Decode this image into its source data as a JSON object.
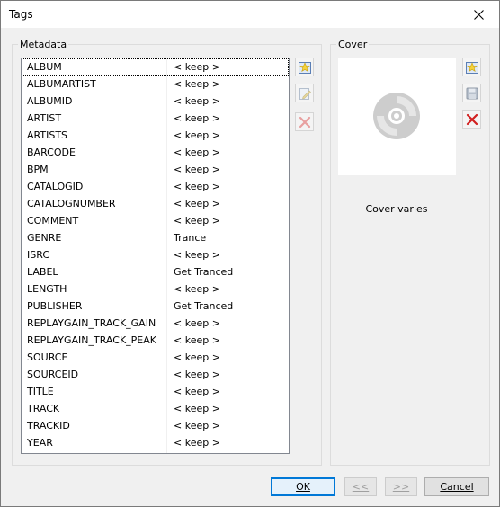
{
  "window": {
    "title": "Tags"
  },
  "metadata": {
    "group_label_prefix": "M",
    "group_label_rest": "etadata",
    "tags": [
      {
        "key": "ALBUM",
        "value": "< keep >"
      },
      {
        "key": "ALBUMARTIST",
        "value": "< keep >"
      },
      {
        "key": "ALBUMID",
        "value": "< keep >"
      },
      {
        "key": "ARTIST",
        "value": "< keep >"
      },
      {
        "key": "ARTISTS",
        "value": "< keep >"
      },
      {
        "key": "BARCODE",
        "value": "< keep >"
      },
      {
        "key": "BPM",
        "value": "< keep >"
      },
      {
        "key": "CATALOGID",
        "value": "< keep >"
      },
      {
        "key": "CATALOGNUMBER",
        "value": "< keep >"
      },
      {
        "key": "COMMENT",
        "value": "< keep >"
      },
      {
        "key": "GENRE",
        "value": "Trance"
      },
      {
        "key": "ISRC",
        "value": "< keep >"
      },
      {
        "key": "LABEL",
        "value": "Get Tranced"
      },
      {
        "key": "LENGTH",
        "value": "< keep >"
      },
      {
        "key": "PUBLISHER",
        "value": "Get Tranced"
      },
      {
        "key": "REPLAYGAIN_TRACK_GAIN",
        "value": "< keep >"
      },
      {
        "key": "REPLAYGAIN_TRACK_PEAK",
        "value": "< keep >"
      },
      {
        "key": "SOURCE",
        "value": "< keep >"
      },
      {
        "key": "SOURCEID",
        "value": "< keep >"
      },
      {
        "key": "TITLE",
        "value": "< keep >"
      },
      {
        "key": "TRACK",
        "value": "< keep >"
      },
      {
        "key": "TRACKID",
        "value": "< keep >"
      },
      {
        "key": "YEAR",
        "value": "< keep >"
      }
    ],
    "actions": [
      {
        "icon": "add-star-icon",
        "enabled": true
      },
      {
        "icon": "edit-note-icon",
        "enabled": false
      },
      {
        "icon": "delete-x-icon",
        "enabled": false
      }
    ]
  },
  "cover": {
    "group_label": "Cover",
    "caption": "Cover varies",
    "image_icon": "cd-disc-icon",
    "actions": [
      {
        "icon": "add-star-icon",
        "enabled": true
      },
      {
        "icon": "save-disk-icon",
        "enabled": false
      },
      {
        "icon": "delete-x-icon",
        "enabled": true
      }
    ]
  },
  "footer": {
    "ok_label": "OK",
    "prev_label": "<<",
    "next_label": ">>",
    "cancel_label": "Cancel"
  },
  "colors": {
    "accent": "#0078d7",
    "delete_red": "#d12020",
    "disabled_red": "#e8a0a0"
  }
}
